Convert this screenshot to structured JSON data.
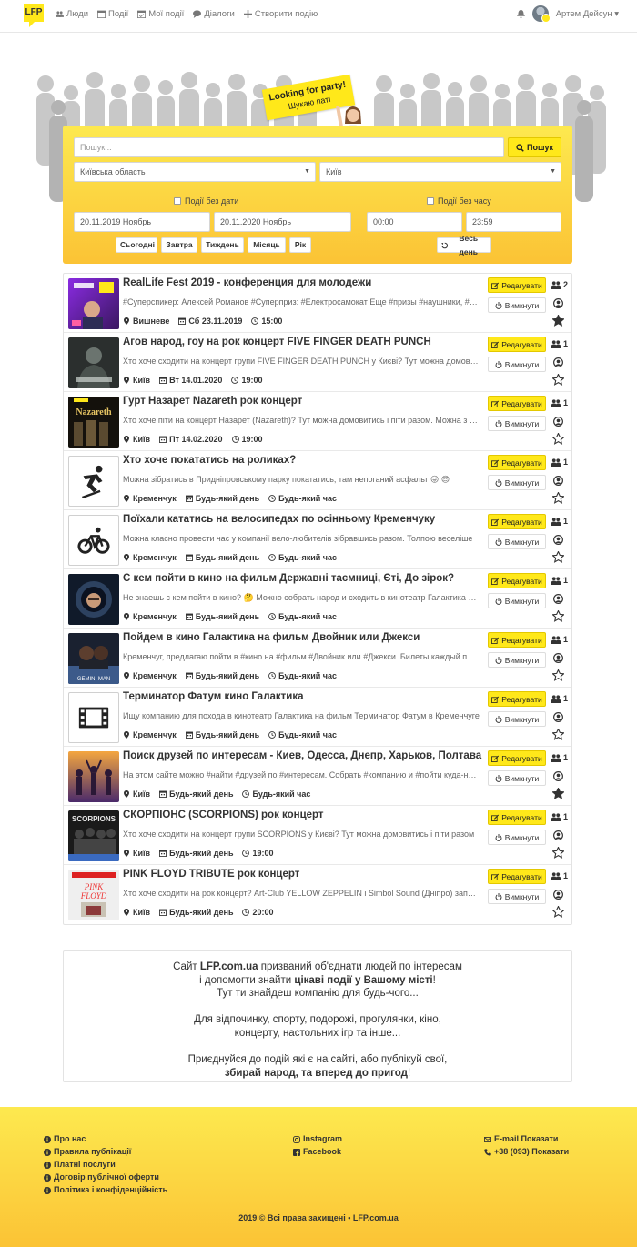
{
  "nav": {
    "logo": "LFP",
    "links": [
      "Люди",
      "Події",
      "Мої події",
      "Діалоги",
      "Створити подію"
    ],
    "user_name": "Артем Дейсун ▾"
  },
  "hero": {
    "sign_main": "Looking for party!",
    "sign_sub": "Шукаю паті"
  },
  "search": {
    "placeholder": "Пошук...",
    "button": "Пошук",
    "region": "Київська область",
    "city": "Київ",
    "no_date_label": "Події без дати",
    "no_time_label": "Події без часу",
    "date_from": "20.11.2019 Ноябрь",
    "date_to": "20.11.2020 Ноябрь",
    "time_from": "00:00",
    "time_to": "23:59",
    "quick": [
      "Сьогодні",
      "Завтра",
      "Тиждень",
      "Місяць",
      "Рік"
    ],
    "all_day": "Весь день"
  },
  "labels": {
    "edit": "Редагувати",
    "turn_off": "Вимкнути"
  },
  "events": [
    {
      "title": "RealLife Fest 2019 - конференция для молодежи",
      "desc": "#Суперспикер: Алексей Романов #Суперприз: #Електросамокат Еще #призы #наушники, #Powerbank-и",
      "place": "Вишневе",
      "date": "Сб 23.11.2019",
      "time": "15:00",
      "count": "2",
      "starred": true,
      "thumb": "fest"
    },
    {
      "title": "Агов народ, гоу на рок концерт FIVE FINGER DEATH PUNCH",
      "desc": "Хто хоче сходити на концерт групи FIVE FINGER DEATH PUNCH у Києві? Тут можна домовитись і піти разом",
      "place": "Київ",
      "date": "Вт 14.01.2020",
      "time": "19:00",
      "count": "1",
      "starred": false,
      "thumb": "ffdp"
    },
    {
      "title": "Гурт Назарет Nazareth рок концерт",
      "desc": "Хто хоче піти на концерт Назарет (Nazareth)? Тут можна домовитись і піти разом. Можна з компанією",
      "place": "Київ",
      "date": "Пт 14.02.2020",
      "time": "19:00",
      "count": "1",
      "starred": false,
      "thumb": "nazareth"
    },
    {
      "title": "Хто хоче покататись на роликах?",
      "desc": "Можна зібратись в Придніпровському парку покататись, там непоганий асфальт 😜 😎",
      "place": "Кременчук",
      "date": "Будь-який день",
      "time": "Будь-який час",
      "count": "1",
      "starred": false,
      "thumb": "skate"
    },
    {
      "title": "Поїхали кататись на велосипедах по осінньому Кременчуку",
      "desc": "Можна класно провести час у компанії вело-любителів зібравшись разом. Толпою веселіше",
      "place": "Кременчук",
      "date": "Будь-який день",
      "time": "Будь-який час",
      "count": "1",
      "starred": false,
      "thumb": "bike"
    },
    {
      "title": "С кем пойти в кино на фильм Державні таємниці, Єті, До зірок?",
      "desc": "Не знаешь с кем пойти в кино? 🤔 Можно собрать народ и сходить в кинотеатр Галактика вместе",
      "place": "Кременчук",
      "date": "Будь-який день",
      "time": "Будь-який час",
      "count": "1",
      "starred": false,
      "thumb": "astro"
    },
    {
      "title": "Пойдем в кино Галактика на фильм Двойник или Джекси",
      "desc": "Кременчуг, предлагаю пойти в #кино на #фильм #Двойник или #Джекси. Билеты каждый покупает сам",
      "place": "Кременчук",
      "date": "Будь-який день",
      "time": "Будь-який час",
      "count": "1",
      "starred": false,
      "thumb": "gemini"
    },
    {
      "title": "Терминатор Фатум кино Галактика",
      "desc": "Ищу компанию для похода в кинотеатр Галактика на фильм Терминатор Фатум в Кременчуге",
      "place": "Кременчук",
      "date": "Будь-який день",
      "time": "Будь-який час",
      "count": "1",
      "starred": false,
      "thumb": "film"
    },
    {
      "title": "Поиск друзей по интересам - Киев, Одесса, Днепр, Харьков, Полтава",
      "desc": "На этом сайте можно #найти #друзей по #интересам. Собрать #компанию и #пойти куда-нибудь вместе",
      "place": "Київ",
      "date": "Будь-який день",
      "time": "Будь-який час",
      "count": "1",
      "starred": true,
      "thumb": "party"
    },
    {
      "title": "СКОРПІОНС (SCORPIONS) рок концерт",
      "desc": "Хто хоче сходити на концерт групи SCORPIONS у Києві? Тут можна домовитись і піти разом",
      "place": "Київ",
      "date": "Будь-який день",
      "time": "19:00",
      "count": "1",
      "starred": false,
      "thumb": "scorpions"
    },
    {
      "title": "PINK FLOYD TRIBUTE рок концерт",
      "desc": "Хто хоче сходити на рок концерт? Art-Club YELLOW ZEPPELIN і Simbol Sound (Дніпро) запрошують",
      "place": "Київ",
      "date": "Будь-який день",
      "time": "20:00",
      "count": "1",
      "starred": false,
      "thumb": "pinkfloyd"
    }
  ],
  "about": {
    "l1a": "Сайт ",
    "l1b": "LFP.com.ua",
    "l1c": " призваний об'єднати людей по інтересам",
    "l2a": "і допомогти знайти ",
    "l2b": "цікаві події у Вашому місті",
    "l2c": "!",
    "l3": "Тут ти знайдеш компанію для будь-чого...",
    "l4": "Для відпочинку, спорту, подорожі, прогулянки, кіно,",
    "l5": "концерту, настольних ігр та інше...",
    "l6": "Приєднуйся до подій які є на сайті, або публікуй свої,",
    "l7a": "збирай народ, та вперед до пригод",
    "l7b": "!"
  },
  "footer": {
    "col1": [
      "Про нас",
      "Правила публікації",
      "Платні послуги",
      "Договір публічної оферти",
      "Політика і конфіденційність"
    ],
    "col2": [
      "Instagram",
      "Facebook"
    ],
    "col3": [
      "E-mail Показати",
      "+38 (093) Показати"
    ],
    "copyright": "2019 © Всі права захищені • LFP.com.ua"
  },
  "colors": {
    "accent": "#ffe81a",
    "footer_top": "#fde94f",
    "footer_bottom": "#fbc335"
  }
}
